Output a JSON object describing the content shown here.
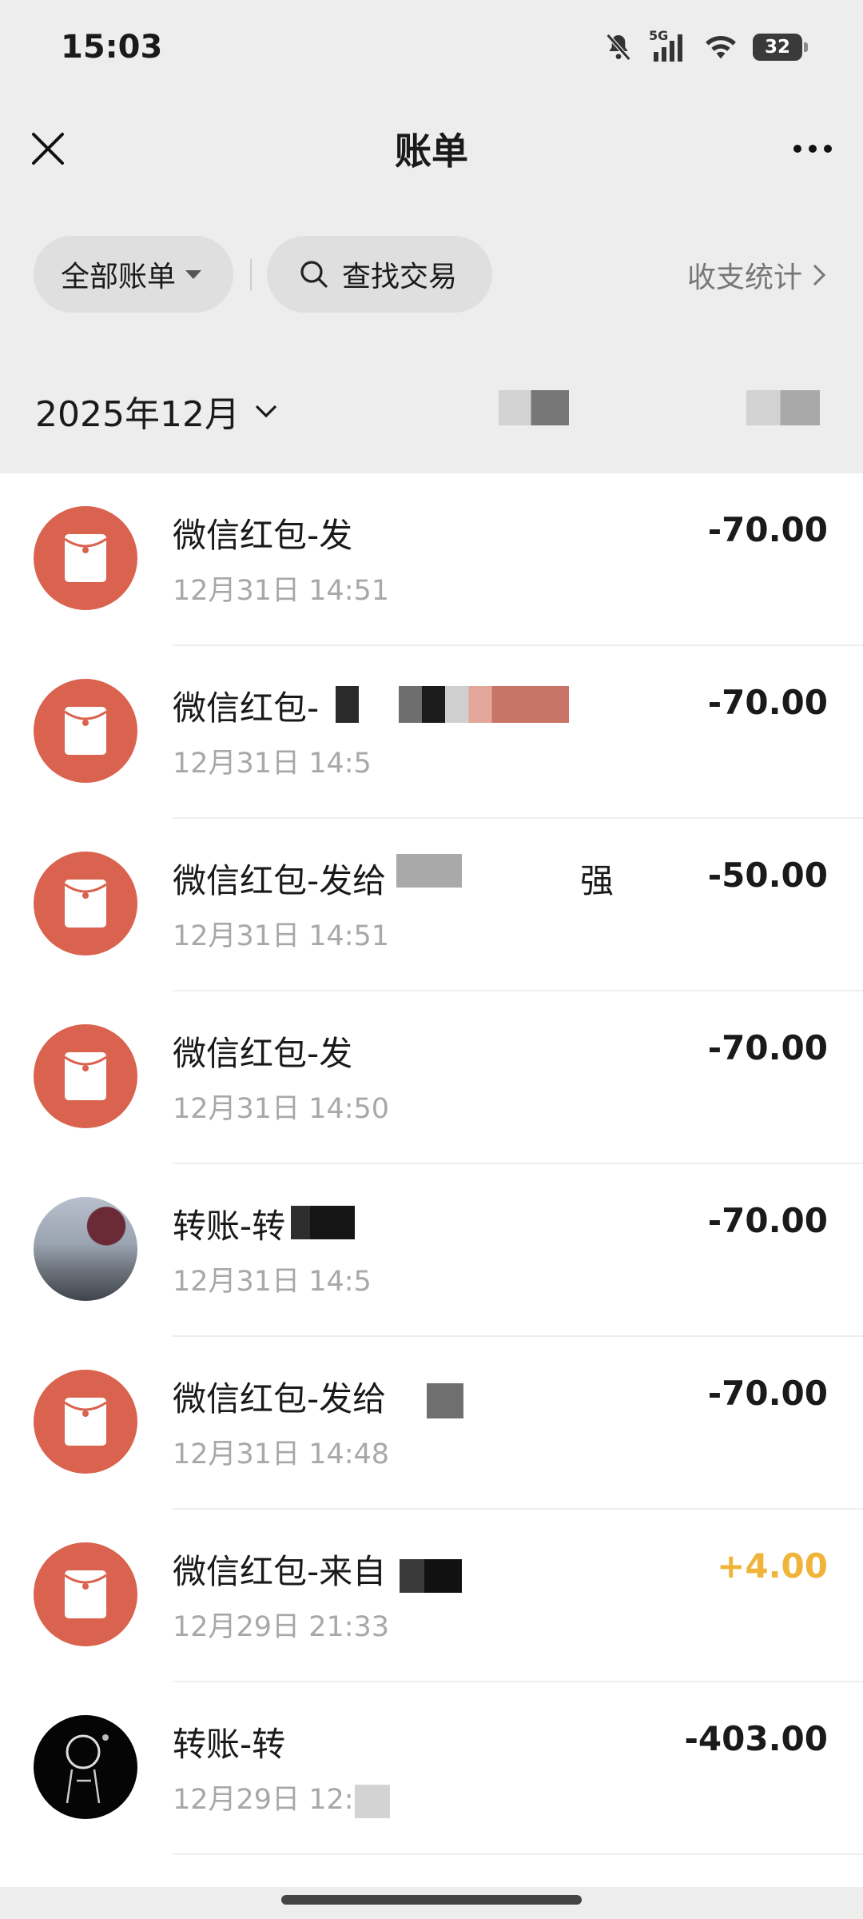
{
  "status_bar": {
    "time": "15:03",
    "network": "5G",
    "battery": "32",
    "icons": [
      "bell-off-icon",
      "signal-icon",
      "wifi-icon",
      "battery-icon"
    ]
  },
  "header": {
    "title": "账单",
    "close_icon": "close-icon",
    "more_icon": "more-icon"
  },
  "filters": {
    "all_bills_label": "全部账单",
    "search_label": "查找交易",
    "stats_label": "收支统计"
  },
  "month": {
    "label": "2025年12月"
  },
  "colors": {
    "red_packet": "#d9634f",
    "income": "#f0b43a",
    "background": "#ededed"
  },
  "transactions": [
    {
      "title": "微信红包-发",
      "time": "12月31日 14:51",
      "amount": "-70.00",
      "type": "red-packet"
    },
    {
      "title": "微信红包-",
      "time": "12月31日 14:5",
      "amount": "-70.00",
      "type": "red-packet"
    },
    {
      "title": "微信红包-发给",
      "title_tail": "强",
      "time": "12月31日 14:51",
      "amount": "-50.00",
      "type": "red-packet"
    },
    {
      "title": "微信红包-发",
      "time": "12月31日 14:50",
      "amount": "-70.00",
      "type": "red-packet"
    },
    {
      "title": "转账-转",
      "time": "12月31日 14:5",
      "amount": "-70.00",
      "type": "transfer-avatar-photo"
    },
    {
      "title": "微信红包-发给",
      "time": "12月31日 14:48",
      "amount": "-70.00",
      "type": "red-packet"
    },
    {
      "title": "微信红包-来自",
      "time": "12月29日 21:33",
      "amount": "+4.00",
      "type": "red-packet-income"
    },
    {
      "title": "转账-转",
      "time": "12月29日 12:",
      "amount": "-403.00",
      "type": "transfer-avatar-dark"
    }
  ]
}
